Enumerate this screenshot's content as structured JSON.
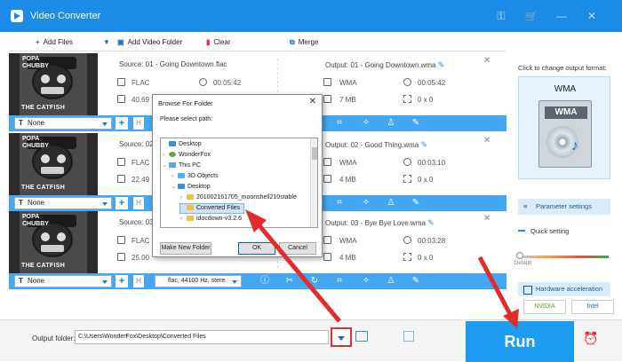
{
  "app": {
    "title": "Video Converter"
  },
  "toolbar": {
    "add_files": "Add Files",
    "add_video_folder": "Add Video Folder",
    "clear": "Clear",
    "merge": "Merge"
  },
  "rows": [
    {
      "source": "Source: 01 - Going Downtown.flac",
      "src_format": "FLAC",
      "src_duration": "00:05:42",
      "src_size": "40.69",
      "output": "Output: 01 - Going Downtown.wma",
      "out_format": "WMA",
      "out_duration": "00:05:42",
      "out_size": "7 MB",
      "out_res": "0 x 0",
      "subtitle": "None"
    },
    {
      "source": "Source: 02",
      "src_format": "FLAC",
      "src_duration": "",
      "src_size": "22.49",
      "output": "Output: 02 - Good Thing.wma",
      "out_format": "WMA",
      "out_duration": "00:03:10",
      "out_size": "4 MB",
      "out_res": "0 x 0",
      "subtitle": "None"
    },
    {
      "source": "Source: 03",
      "src_format": "FLAC",
      "src_duration": "",
      "src_size": "25.00",
      "output": "Output: 03 - Bye Bye Love.wma",
      "out_format": "WMA",
      "out_duration": "00:03:28",
      "out_size": "4 MB",
      "out_res": "0 x 0",
      "subtitle": "None",
      "audio_track": "flac, 44100 Hz, stere"
    }
  ],
  "thumbnail": {
    "band": "POPA CHUBBY",
    "album": "THE CATFISH"
  },
  "right_panel": {
    "hint": "Click to change output format:",
    "format": "WMA",
    "format_icon_label": "WMA",
    "parameter_settings": "Parameter settings",
    "quick_setting": "Quick setting",
    "default_label": "Default",
    "hardware_acceleration": "Hardware acceleration",
    "nvidia": "NVIDIA",
    "intel": "Intel"
  },
  "footer": {
    "output_folder_label": "Output folder:",
    "output_path": "C:\\Users\\WonderFox\\Desktop\\Converted Files",
    "run": "Run"
  },
  "dialog": {
    "title": "Browse For Folder",
    "prompt": "Please select path:",
    "tree": [
      "Desktop",
      "WonderFox",
      "This PC",
      "3D Objects",
      "Desktop",
      "201002161705_moonshell210stable",
      "Converted Files",
      "idocdown-v3.2.6"
    ],
    "make_new_folder": "Make New Folder",
    "ok": "OK",
    "cancel": "Cancel"
  },
  "colors": {
    "brand_blue": "#1d8ce6",
    "bar_blue": "#43a8f1",
    "arrow_red": "#e32b2b"
  }
}
